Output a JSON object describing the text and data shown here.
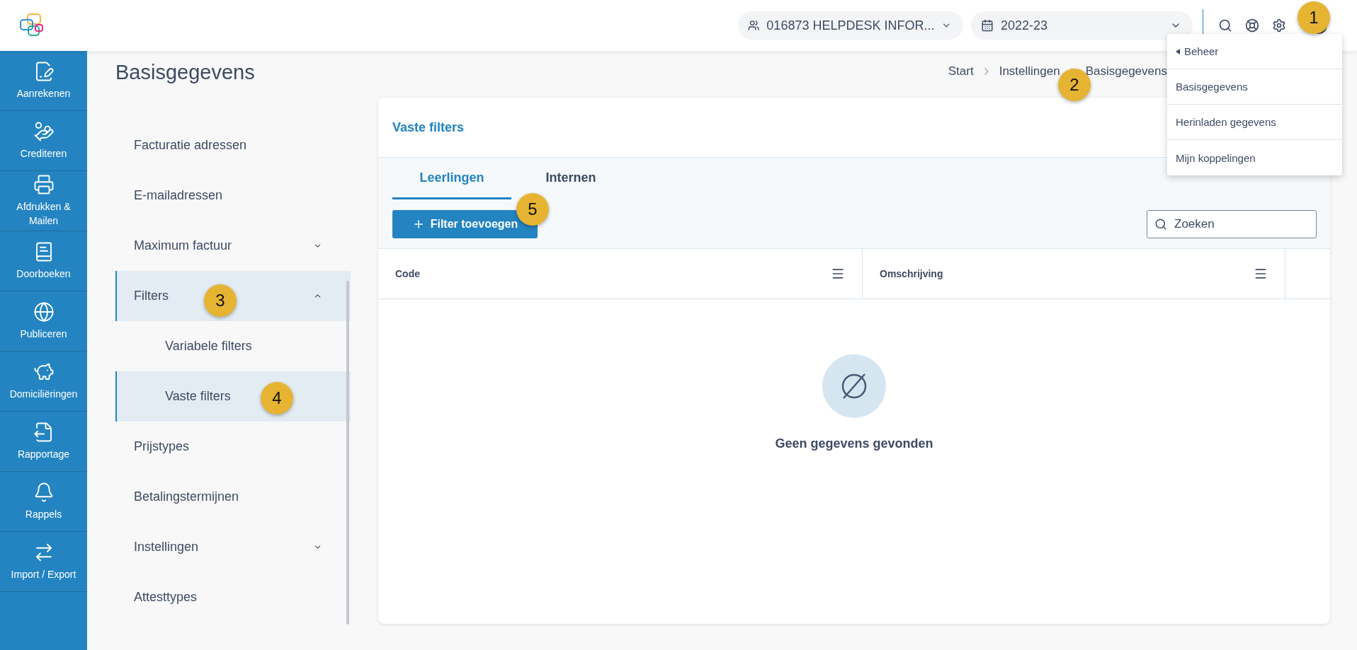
{
  "header": {
    "organisation": "016873 HELPDESK INFOR...",
    "school_year": "2022-23"
  },
  "nav": [
    {
      "label": "Aanrekenen"
    },
    {
      "label": "Crediteren"
    },
    {
      "label": "Afdrukken & Mailen"
    },
    {
      "label": "Doorboeken"
    },
    {
      "label": "Publiceren"
    },
    {
      "label": "Domiciliëringen"
    },
    {
      "label": "Rapportage"
    },
    {
      "label": "Rappels"
    },
    {
      "label": "Import / Export"
    }
  ],
  "page_title": "Basisgegevens",
  "breadcrumb": [
    "Start",
    "Instellingen",
    "Basisgegevens"
  ],
  "settings_menu": [
    {
      "label": "Facturatie adressen",
      "selected": false
    },
    {
      "label": "E-mailadressen",
      "selected": false
    },
    {
      "label": "Maximum factuur",
      "selected": false,
      "expanded": false
    },
    {
      "label": "Filters",
      "selected": true,
      "expanded": true,
      "children": [
        {
          "label": "Variabele filters",
          "selected": false
        },
        {
          "label": "Vaste filters",
          "selected": true
        }
      ]
    },
    {
      "label": "Prijstypes",
      "selected": false
    },
    {
      "label": "Betalingstermijnen",
      "selected": false
    },
    {
      "label": "Instellingen",
      "selected": false,
      "expanded": false
    },
    {
      "label": "Attesttypes",
      "selected": false
    }
  ],
  "card": {
    "title": "Vaste filters",
    "tabs": [
      {
        "label": "Leerlingen",
        "selected": true
      },
      {
        "label": "Internen",
        "selected": false
      }
    ],
    "add_button": "Filter toevoegen",
    "search": {
      "placeholder": "Zoeken"
    },
    "columns": [
      "Code",
      "Omschrijving"
    ],
    "empty_message": "Geen gegevens gevonden"
  },
  "user_menu": {
    "back": "Beheer",
    "items": [
      "Basisgegevens",
      "Herinladen gegevens",
      "Mijn koppelingen"
    ]
  },
  "callouts": [
    "1",
    "2",
    "3",
    "4",
    "5"
  ]
}
